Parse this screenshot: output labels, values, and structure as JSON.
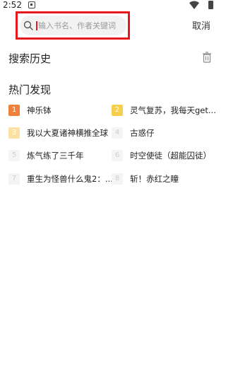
{
  "status_bar": {
    "time": "2:52"
  },
  "search": {
    "placeholder": "输入书名、作者关键词",
    "value": "",
    "cancel_label": "取消"
  },
  "history": {
    "title": "搜索历史"
  },
  "hot": {
    "title": "热门发现",
    "items": [
      {
        "rank": "1",
        "title": "神乐钵"
      },
      {
        "rank": "2",
        "title": "灵气复苏，我每天get..."
      },
      {
        "rank": "3",
        "title": "我以大夏诸神横推全球"
      },
      {
        "rank": "4",
        "title": "古惑仔"
      },
      {
        "rank": "5",
        "title": "炼气练了三千年"
      },
      {
        "rank": "6",
        "title": "时空使徒（超能囚徒）"
      },
      {
        "rank": "7",
        "title": "重生为怪兽什么鬼2：..."
      },
      {
        "rank": "8",
        "title": "斩！赤红之瞳"
      }
    ]
  },
  "colors": {
    "highlight_border": "#e8161d",
    "rank1": "#f0813a",
    "rank2": "#f8cf4d",
    "rank3": "#fbe2a3",
    "rank_other": "#f4f4f4"
  }
}
